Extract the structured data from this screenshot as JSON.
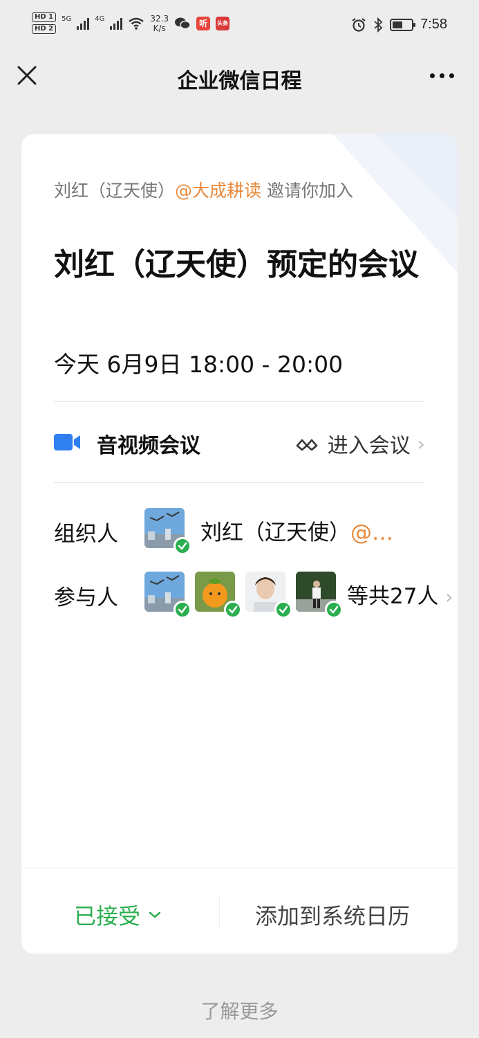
{
  "status_bar": {
    "hd1": "HD 1",
    "hd2": "HD 2",
    "net1": "5G",
    "net2": "4G",
    "speed_value": "32.3",
    "speed_unit": "K/s",
    "app1": "听",
    "app2": "头条",
    "time": "7:58"
  },
  "title_bar": {
    "title": "企业微信日程"
  },
  "card": {
    "inviter_name": "刘红（辽天使）",
    "inviter_at": "@大成耕读",
    "inviter_suffix": " 邀请你加入",
    "meeting_title": "刘红（辽天使）预定的会议",
    "meeting_time": "今天 6月9日 18:00 - 20:00",
    "video_label": "音视频会议",
    "enter_label": "进入会议",
    "organizer_label": "组织人",
    "organizer_name": "刘红（辽天使）",
    "organizer_at": "@…",
    "participants_label": "参与人",
    "participants_total": "等共27人",
    "accepted_label": "已接受",
    "add_calendar_label": "添加到系统日历"
  },
  "learn_more": "了解更多",
  "colors": {
    "accent_orange": "#e8893a",
    "accept_green": "#2aae4f",
    "video_blue": "#2f7ff0"
  }
}
